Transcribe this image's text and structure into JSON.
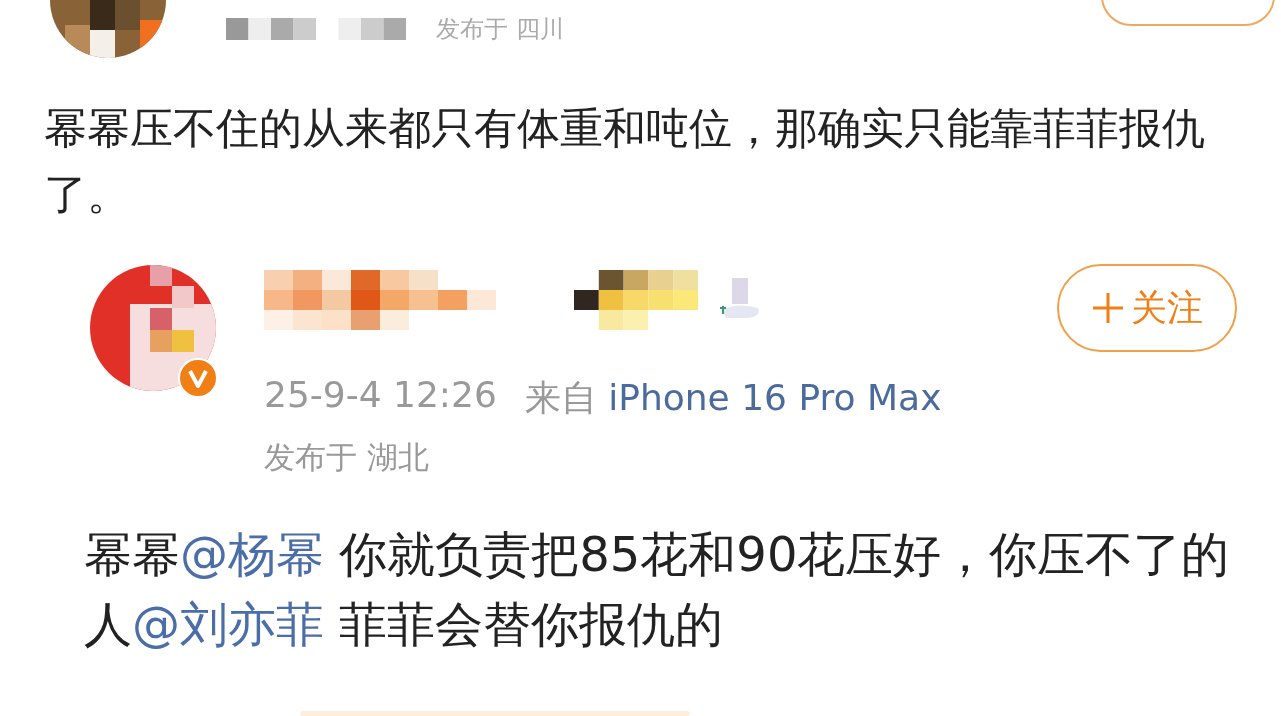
{
  "top_post": {
    "location": "发布于 四川",
    "text": "幂幂压不住的从来都只有体重和吨位，那确实只能靠菲菲报仇了。"
  },
  "quoted_post": {
    "verified": true,
    "time": "25-9-4 12:26",
    "source_prefix": "来自",
    "source": "iPhone 16 Pro Max",
    "location": "发布于 湖北",
    "follow_label": "关注",
    "segments": [
      {
        "kind": "text",
        "text": "幂幂"
      },
      {
        "kind": "mention",
        "text": "@杨幂"
      },
      {
        "kind": "text",
        "text": " 你就负责把85花和90花压好，你压不了的人"
      },
      {
        "kind": "mention",
        "text": "@刘亦菲"
      },
      {
        "kind": "text",
        "text": " 菲菲会替你报仇的"
      }
    ]
  }
}
